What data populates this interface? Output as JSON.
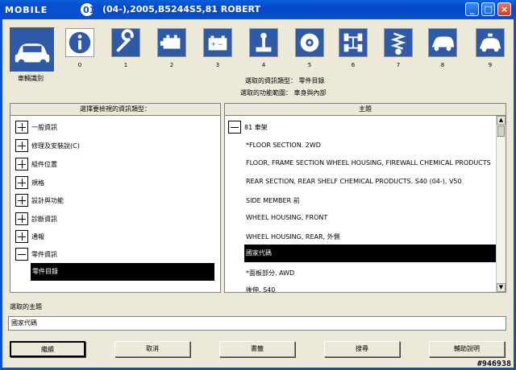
{
  "window": {
    "logo_text": "MOBILE01",
    "title": "(04-),2005,B5244S5,81 ROBERT",
    "minimize": "_",
    "maximize": "□",
    "close": "×"
  },
  "toolbar": {
    "main_label": "車輛識別",
    "tools": [
      {
        "num": "0",
        "icon": "info-icon"
      },
      {
        "num": "1",
        "icon": "wrench-icon"
      },
      {
        "num": "2",
        "icon": "engine-icon"
      },
      {
        "num": "3",
        "icon": "battery-icon"
      },
      {
        "num": "4",
        "icon": "gear-shift-icon"
      },
      {
        "num": "5",
        "icon": "brake-disc-icon"
      },
      {
        "num": "6",
        "icon": "axle-icon"
      },
      {
        "num": "7",
        "icon": "suspension-spring-icon"
      },
      {
        "num": "8",
        "icon": "car-body-icon"
      },
      {
        "num": "9",
        "icon": "police-car-icon"
      }
    ]
  },
  "selection_info": {
    "info_type": "選取的資訊類型： 零件目錄",
    "function_scope": "選取的功能範圍： 車身與內部"
  },
  "left_panel": {
    "header": "選擇要檢視的資訊類型：",
    "items": [
      {
        "label": "一般資訊",
        "expanded": false
      },
      {
        "label": "修理及安裝說(C)",
        "expanded": false
      },
      {
        "label": "組件位置",
        "expanded": false
      },
      {
        "label": "規格",
        "expanded": false
      },
      {
        "label": "設計與功能",
        "expanded": false
      },
      {
        "label": "診斷資訊",
        "expanded": false
      },
      {
        "label": "通報",
        "expanded": false
      },
      {
        "label": "零件資訊",
        "expanded": true
      }
    ],
    "selected_child": "零件目錄"
  },
  "right_panel": {
    "header": "主題",
    "root": "81 車架",
    "topics": [
      "*FLOOR SECTION. 2WD",
      "FLOOR, FRAME SECTION WHEEL HOUSING, FIREWALL CHEMICAL PRODUCTS",
      "REAR SECTION, REAR SHELF CHEMICAL PRODUCTS. S40 (04-), V50",
      "SIDE MEMBER 前",
      "WHEEL HOUSING, FRONT",
      "WHEEL HOUSING, REAR, 外側",
      "國家代碼",
      "*面板部分. AWD",
      "後伸. S40"
    ],
    "selected_topic": "國家代碼",
    "scroll_up": "▲",
    "scroll_down": "▼"
  },
  "selected_topic_field": {
    "label": "選取的主題",
    "value": "國家代碼"
  },
  "buttons": {
    "continue": "繼續",
    "cancel": "取消",
    "print": "書籤",
    "search": "搜尋",
    "help": "輔助說明"
  },
  "watermark": "#946938"
}
